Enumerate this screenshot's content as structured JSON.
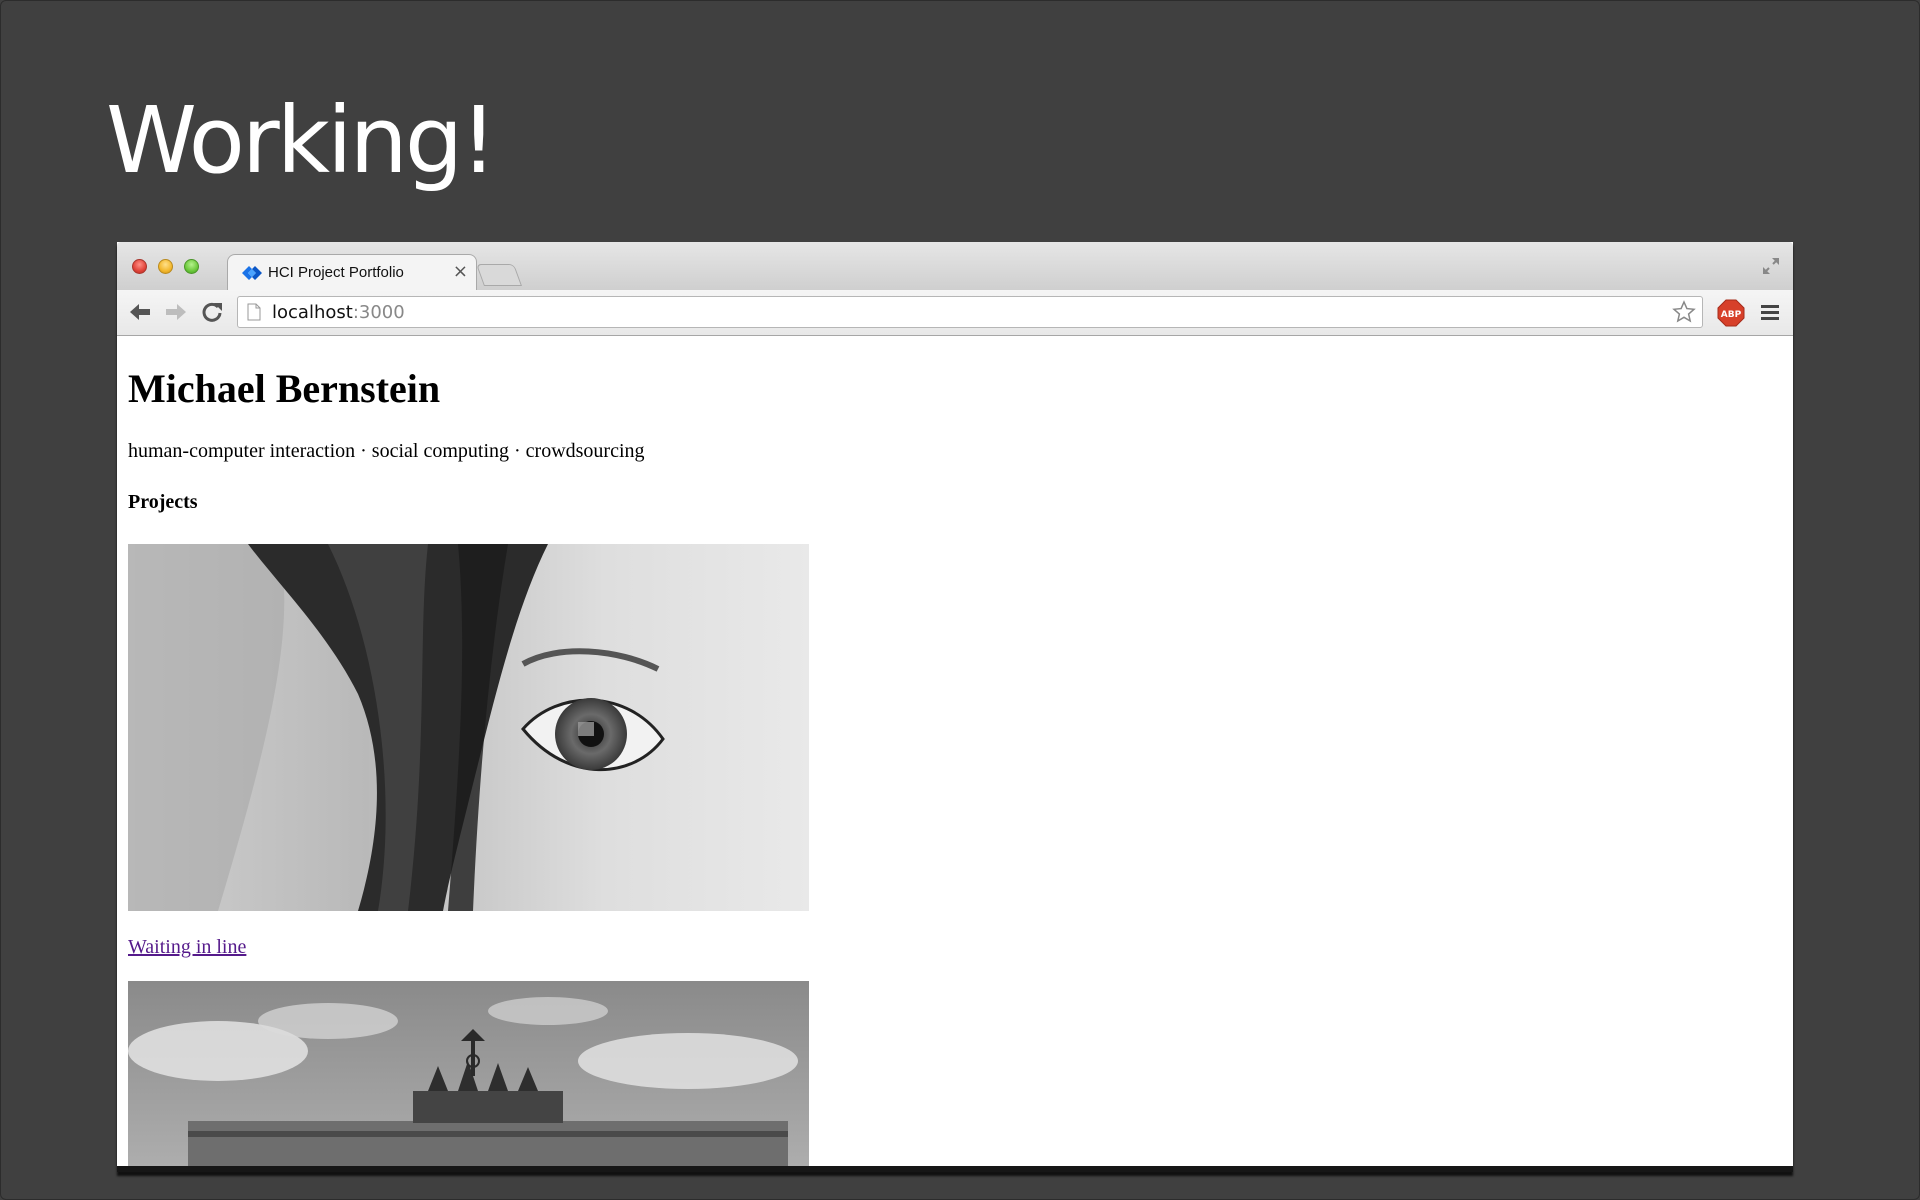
{
  "slide": {
    "title": "Working!"
  },
  "browser": {
    "tab_title": "HCI Project Portfolio",
    "tab_close": "×",
    "url_host": "localhost",
    "url_port": ":3000"
  },
  "page": {
    "heading": "Michael Bernstein",
    "tagline": "human-computer interaction · social computing · crowdsourcing",
    "section_title": "Projects",
    "projects": [
      {
        "link_text": "Waiting in line"
      }
    ]
  },
  "colors": {
    "slide_background": "#404040",
    "visited_link": "#551a8b",
    "abp_badge": "#d7402a"
  },
  "icons": [
    "chrome-tab-favicon",
    "back-arrow-icon",
    "forward-arrow-icon",
    "reload-icon",
    "page-icon",
    "star-icon",
    "adblock-plus-icon",
    "hamburger-menu-icon",
    "fullscreen-icon"
  ]
}
